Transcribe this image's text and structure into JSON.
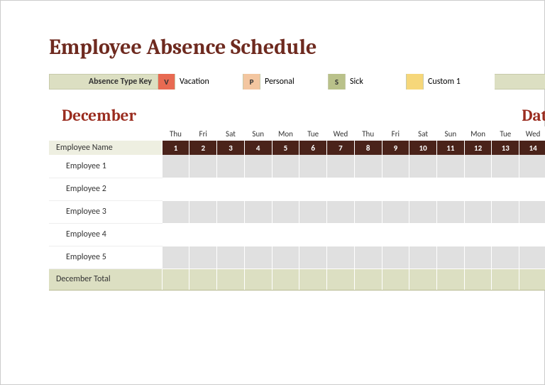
{
  "title": "Employee Absence Schedule",
  "key": {
    "label": "Absence Type Key",
    "items": [
      {
        "code": "V",
        "label": "Vacation",
        "bg": "#e86a52"
      },
      {
        "code": "P",
        "label": "Personal",
        "bg": "#f3c6a0"
      },
      {
        "code": "S",
        "label": "Sick",
        "bg": "#b9c18a"
      },
      {
        "code": "",
        "label": "Custom 1",
        "bg": "#f6d77a"
      }
    ]
  },
  "month": "December",
  "dates_hint": "Dat",
  "header": {
    "name_col": "Employee Name",
    "days_of_week": [
      "Thu",
      "Fri",
      "Sat",
      "Sun",
      "Mon",
      "Tue",
      "Wed",
      "Thu",
      "Fri",
      "Sat",
      "Sun",
      "Mon",
      "Tue",
      "Wed"
    ],
    "day_numbers": [
      "1",
      "2",
      "3",
      "4",
      "5",
      "6",
      "7",
      "8",
      "9",
      "10",
      "11",
      "12",
      "13",
      "14"
    ]
  },
  "employees": [
    "Employee 1",
    "Employee 2",
    "Employee 3",
    "Employee 4",
    "Employee 5"
  ],
  "total_label": "December Total",
  "chart_data": {
    "type": "table",
    "title": "Employee Absence Schedule — December",
    "columns": [
      "Employee Name",
      "1",
      "2",
      "3",
      "4",
      "5",
      "6",
      "7",
      "8",
      "9",
      "10",
      "11",
      "12",
      "13",
      "14"
    ],
    "rows": [
      [
        "Employee 1",
        "",
        "",
        "",
        "",
        "",
        "",
        "",
        "",
        "",
        "",
        "",
        "",
        "",
        ""
      ],
      [
        "Employee 2",
        "",
        "",
        "",
        "",
        "",
        "",
        "",
        "",
        "",
        "",
        "",
        "",
        "",
        ""
      ],
      [
        "Employee 3",
        "",
        "",
        "",
        "",
        "",
        "",
        "",
        "",
        "",
        "",
        "",
        "",
        "",
        ""
      ],
      [
        "Employee 4",
        "",
        "",
        "",
        "",
        "",
        "",
        "",
        "",
        "",
        "",
        "",
        "",
        "",
        ""
      ],
      [
        "Employee 5",
        "",
        "",
        "",
        "",
        "",
        "",
        "",
        "",
        "",
        "",
        "",
        "",
        "",
        ""
      ],
      [
        "December Total",
        "",
        "",
        "",
        "",
        "",
        "",
        "",
        "",
        "",
        "",
        "",
        "",
        "",
        ""
      ]
    ],
    "legend": [
      {
        "code": "V",
        "label": "Vacation"
      },
      {
        "code": "P",
        "label": "Personal"
      },
      {
        "code": "S",
        "label": "Sick"
      },
      {
        "code": "",
        "label": "Custom 1"
      }
    ]
  }
}
